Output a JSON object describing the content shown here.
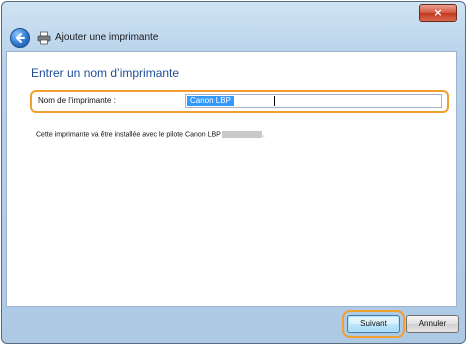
{
  "window": {
    "close_glyph": "×"
  },
  "header": {
    "title": "Ajouter une imprimante",
    "back_icon": "back-arrow-icon",
    "printer_icon": "printer-icon"
  },
  "main": {
    "heading": "Entrer un nom d’imprimante",
    "name_field": {
      "label": "Nom de l’imprimante :",
      "value": "Canon LBP"
    },
    "info_text_before": "Cette imprimante va être installée avec le pilote Canon LBP",
    "info_text_after": "."
  },
  "footer": {
    "next_label": "Suivant",
    "cancel_label": "Annuler"
  },
  "colors": {
    "accent_highlight": "#f0a030",
    "heading_blue": "#1f4e96",
    "selection": "#3399ff"
  }
}
